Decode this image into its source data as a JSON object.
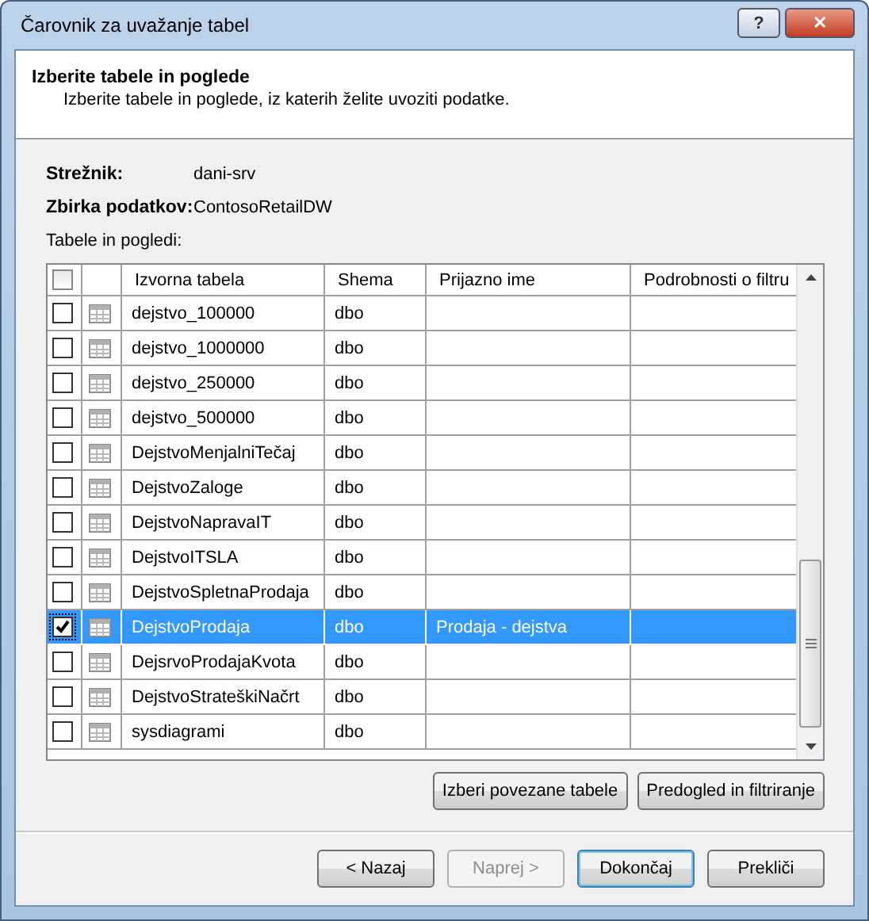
{
  "window": {
    "title": "Čarovnik za uvažanje tabel",
    "title_buttons": [
      {
        "kind": "help",
        "label": "?"
      },
      {
        "kind": "close",
        "label": "✕"
      }
    ]
  },
  "header": {
    "title": "Izberite tabele in poglede",
    "subtitle": "Izberite tabele in poglede, iz katerih želite uvoziti podatke."
  },
  "info": [
    {
      "label": "Strežnik:",
      "value": "dani-srv"
    },
    {
      "label": "Zbirka podatkov:",
      "value": "ContosoRetailDW"
    }
  ],
  "list_label": "Tabele in pogledi:",
  "table": {
    "select_all": {
      "checked": false
    },
    "columns": [
      "Izvorna tabela",
      "Shema",
      "Prijazno ime",
      "Podrobnosti o filtru"
    ],
    "rows": [
      {
        "checked": false,
        "selected": false,
        "name": "dejstvo_100000",
        "schema": "dbo",
        "friendly": ""
      },
      {
        "checked": false,
        "selected": false,
        "name": "dejstvo_1000000",
        "schema": "dbo",
        "friendly": ""
      },
      {
        "checked": false,
        "selected": false,
        "name": "dejstvo_250000",
        "schema": "dbo",
        "friendly": ""
      },
      {
        "checked": false,
        "selected": false,
        "name": "dejstvo_500000",
        "schema": "dbo",
        "friendly": ""
      },
      {
        "checked": false,
        "selected": false,
        "name": "DejstvoMenjalniTečaj",
        "schema": "dbo",
        "friendly": ""
      },
      {
        "checked": false,
        "selected": false,
        "name": "DejstvoZaloge",
        "schema": "dbo",
        "friendly": ""
      },
      {
        "checked": false,
        "selected": false,
        "name": "DejstvoNapravaIT",
        "schema": "dbo",
        "friendly": ""
      },
      {
        "checked": false,
        "selected": false,
        "name": "DejstvoITSLA",
        "schema": "dbo",
        "friendly": ""
      },
      {
        "checked": false,
        "selected": false,
        "name": "DejstvoSpletnaProdaja",
        "schema": "dbo",
        "friendly": ""
      },
      {
        "checked": true,
        "selected": true,
        "name": "DejstvoProdaja",
        "schema": "dbo",
        "friendly": "Prodaja - dejstva"
      },
      {
        "checked": false,
        "selected": false,
        "name": "DejsrvoProdajaKvota",
        "schema": "dbo",
        "friendly": ""
      },
      {
        "checked": false,
        "selected": false,
        "name": "DejstvoStrateškiNačrt",
        "schema": "dbo",
        "friendly": ""
      },
      {
        "checked": false,
        "selected": false,
        "name": "sysdiagrami",
        "schema": "dbo",
        "friendly": ""
      }
    ]
  },
  "list_buttons": [
    {
      "label": "Izberi povezane tabele"
    },
    {
      "label": "Predogled in filtriranje"
    }
  ],
  "nav_buttons": [
    {
      "label": "< Nazaj",
      "disabled": false,
      "default": false
    },
    {
      "label": "Naprej >",
      "disabled": true,
      "default": false
    },
    {
      "label": "Dokončaj",
      "disabled": false,
      "default": true
    },
    {
      "label": "Prekliči",
      "disabled": false,
      "default": false
    }
  ]
}
